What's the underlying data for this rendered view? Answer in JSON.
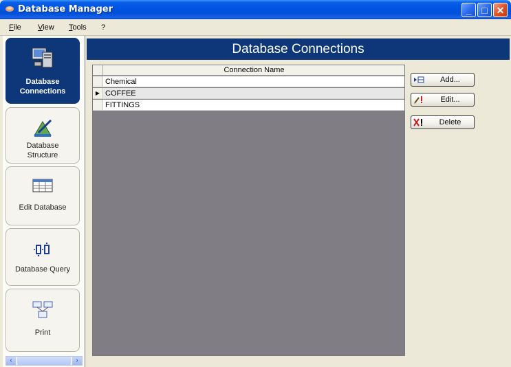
{
  "window": {
    "title": "Database Manager"
  },
  "menu": [
    {
      "label": "File",
      "u": "F",
      "rest": "ile"
    },
    {
      "label": "View",
      "u": "V",
      "rest": "iew"
    },
    {
      "label": "Tools",
      "u": "T",
      "rest": "ools"
    },
    {
      "label": "?",
      "u": "",
      "rest": "?"
    }
  ],
  "sidebar": {
    "items": [
      {
        "label_line1": "Database",
        "label_line2": "Connections",
        "icon": "server-icon",
        "active": true
      },
      {
        "label_line1": "Database",
        "label_line2": "Structure",
        "icon": "blueprint-icon",
        "active": false
      },
      {
        "label_line1": "Edit Database",
        "label_line2": "",
        "icon": "table-edit-icon",
        "active": false
      },
      {
        "label_line1": "Database Query",
        "label_line2": "",
        "icon": "query-icon",
        "active": false
      },
      {
        "label_line1": "Print",
        "label_line2": "",
        "icon": "print-icon",
        "active": false
      }
    ]
  },
  "main": {
    "title": "Database Connections",
    "grid": {
      "column_header": "Connection Name",
      "rows": [
        {
          "name": "Chemical",
          "selected": false
        },
        {
          "name": "COFFEE",
          "selected": true
        },
        {
          "name": "FITTINGS",
          "selected": false
        }
      ]
    },
    "actions": {
      "add": "Add...",
      "edit": "Edit...",
      "delete": "Delete"
    }
  },
  "colors": {
    "titlebar": "#0054e3",
    "header_bg": "#0d3778",
    "grid_bg": "#807d84",
    "window_bg": "#ece9d8"
  }
}
